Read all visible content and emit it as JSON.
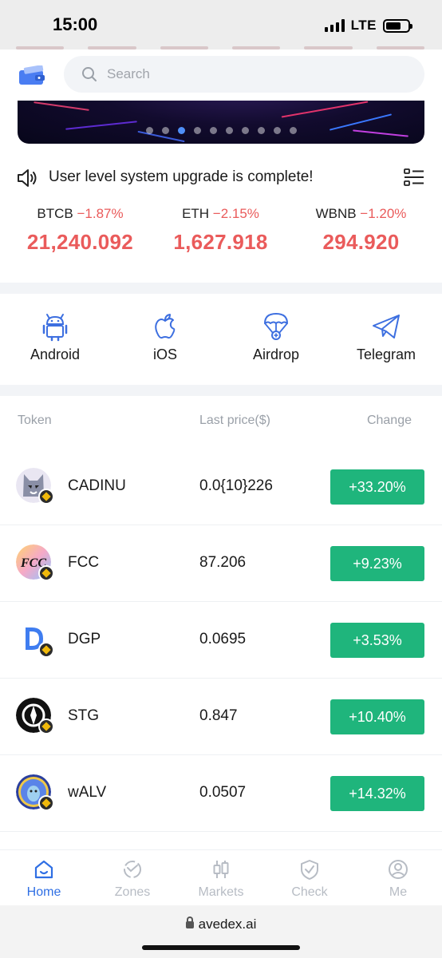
{
  "status_bar": {
    "time": "15:00",
    "network": "LTE"
  },
  "search": {
    "placeholder": "Search"
  },
  "banner": {
    "dot_count": 10,
    "active_dot": 2
  },
  "notice": {
    "text": "User level system upgrade is complete!"
  },
  "tickers": [
    {
      "symbol": "BTCB",
      "change": "−1.87%",
      "price": "21,240.092"
    },
    {
      "symbol": "ETH",
      "change": "−2.15%",
      "price": "1,627.918"
    },
    {
      "symbol": "WBNB",
      "change": "−1.20%",
      "price": "294.920"
    }
  ],
  "downloads": [
    {
      "label": "Android",
      "icon": "android-icon"
    },
    {
      "label": "iOS",
      "icon": "apple-icon"
    },
    {
      "label": "Airdrop",
      "icon": "parachute-icon"
    },
    {
      "label": "Telegram",
      "icon": "telegram-icon"
    }
  ],
  "table": {
    "headers": {
      "token": "Token",
      "price": "Last price($)",
      "change": "Change"
    },
    "rows": [
      {
        "name": "CADINU",
        "price": "0.0{10}226",
        "change": "+33.20%",
        "logo_color": "#8a8fa6"
      },
      {
        "name": "FCC",
        "price": "87.206",
        "change": "+9.23%",
        "logo_color": "#f5a9c8"
      },
      {
        "name": "DGP",
        "price": "0.0695",
        "change": "+3.53%",
        "logo_color": "#3f7df0"
      },
      {
        "name": "STG",
        "price": "0.847",
        "change": "+10.40%",
        "logo_color": "#111111"
      },
      {
        "name": "wALV",
        "price": "0.0507",
        "change": "+14.32%",
        "logo_color": "#4b6fd8"
      }
    ]
  },
  "bottom_nav": [
    {
      "label": "Home",
      "icon": "home-icon",
      "active": true
    },
    {
      "label": "Zones",
      "icon": "zones-icon",
      "active": false
    },
    {
      "label": "Markets",
      "icon": "candlestick-icon",
      "active": false
    },
    {
      "label": "Check",
      "icon": "shield-check-icon",
      "active": false
    },
    {
      "label": "Me",
      "icon": "user-icon",
      "active": false
    }
  ],
  "url_bar": {
    "domain": "avedex.ai"
  },
  "colors": {
    "accent": "#2f6fe4",
    "up": "#1fb57c",
    "down": "#ea5b5b"
  }
}
